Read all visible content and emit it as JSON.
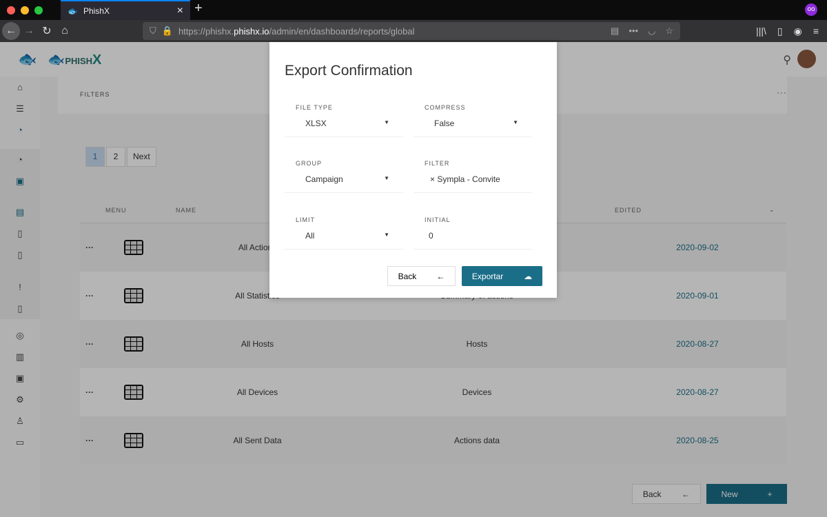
{
  "browser": {
    "tab_title": "PhishX",
    "url_prefix": "https://phishx.",
    "url_domain": "phishx.io",
    "url_path": "/admin/en/dashboards/reports/global"
  },
  "app": {
    "brand": "PHISH",
    "brand_x": "X",
    "filters_label": "FILTERS",
    "more": "···"
  },
  "pagination": {
    "pages": [
      "1",
      "2"
    ],
    "next": "Next",
    "current": "1"
  },
  "table": {
    "headers": {
      "menu": "MENU",
      "name": "NAME",
      "edited": "EDITED"
    },
    "rows": [
      {
        "name": "All Actions",
        "description": "",
        "edited": "2020-09-02"
      },
      {
        "name": "All Statistics",
        "description": "Summary of actions",
        "edited": "2020-09-01"
      },
      {
        "name": "All Hosts",
        "description": "Hosts",
        "edited": "2020-08-27"
      },
      {
        "name": "All Devices",
        "description": "Devices",
        "edited": "2020-08-27"
      },
      {
        "name": "All Sent Data",
        "description": "Actions data",
        "edited": "2020-08-25"
      }
    ]
  },
  "footer": {
    "back": "Back",
    "new": "New"
  },
  "modal": {
    "title": "Export Confirmation",
    "fields": [
      {
        "label": "FILE TYPE",
        "value": "XLSX",
        "type": "select"
      },
      {
        "label": "COMPRESS",
        "value": "False",
        "type": "select"
      },
      {
        "label": "GROUP",
        "value": "Campaign",
        "type": "select"
      },
      {
        "label": "FILTER",
        "value": "Sympla - Convite",
        "type": "tag"
      },
      {
        "label": "LIMIT",
        "value": "All",
        "type": "select"
      },
      {
        "label": "INITIAL",
        "value": "0",
        "type": "input"
      }
    ],
    "back": "Back",
    "export": "Exportar"
  },
  "colors": {
    "accent": "#1b6e88",
    "brand": "#1f8a84"
  }
}
